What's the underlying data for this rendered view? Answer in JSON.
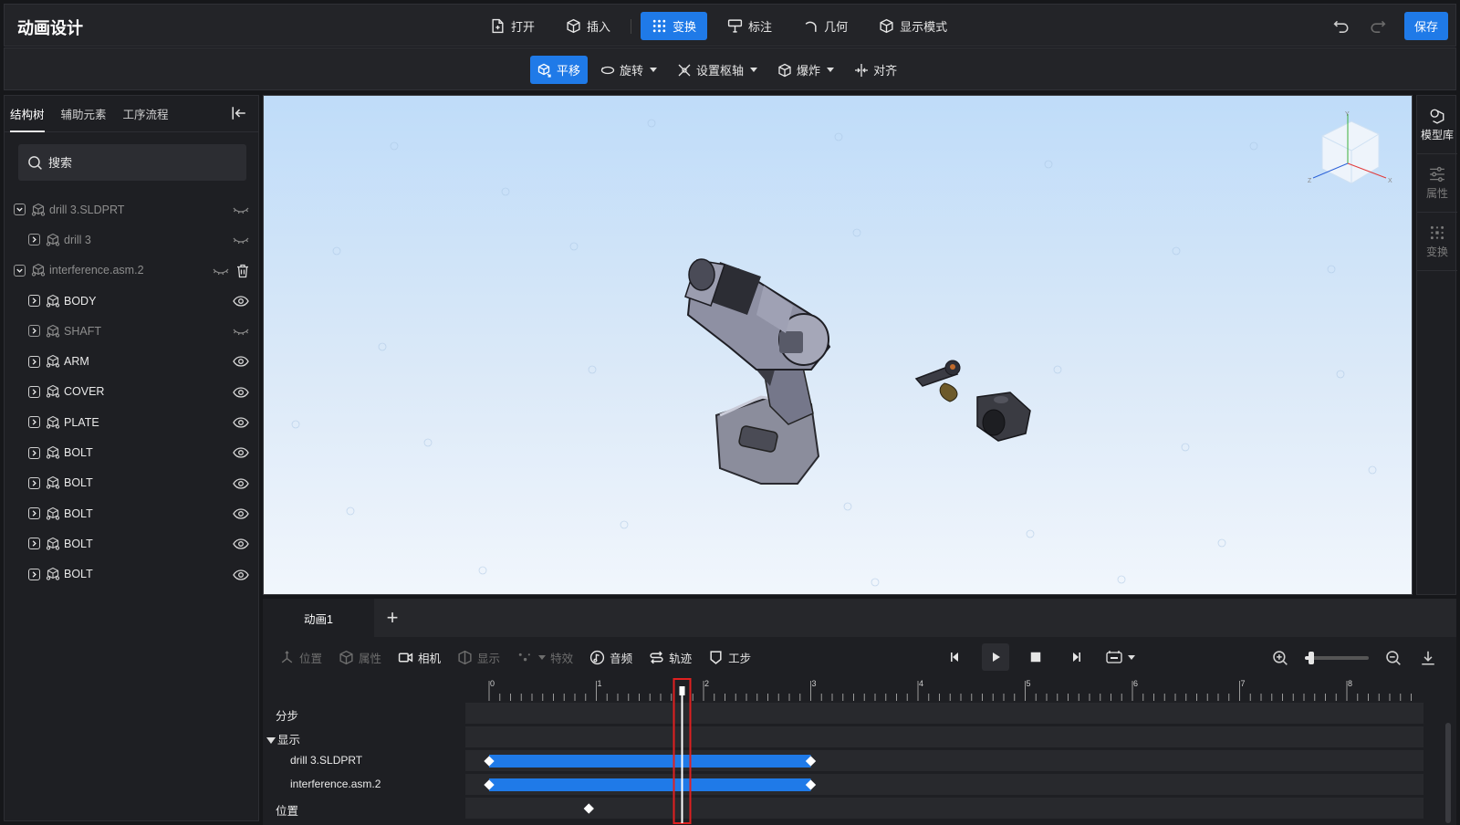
{
  "app": {
    "title": "动画设计"
  },
  "top_menu": [
    {
      "label": "打开",
      "icon": "file-open-icon"
    },
    {
      "label": "插入",
      "icon": "cube-insert-icon"
    },
    {
      "label": "变换",
      "icon": "transform-icon",
      "active": true
    },
    {
      "label": "标注",
      "icon": "annotate-icon"
    },
    {
      "label": "几何",
      "icon": "geometry-icon"
    },
    {
      "label": "显示模式",
      "icon": "display-mode-icon"
    }
  ],
  "top_right": {
    "save_label": "保存"
  },
  "sub_menu": [
    {
      "label": "平移",
      "icon": "translate-icon",
      "active": true
    },
    {
      "label": "旋转",
      "icon": "rotate-icon",
      "dropdown": true
    },
    {
      "label": "设置枢轴",
      "icon": "pivot-icon",
      "dropdown": true
    },
    {
      "label": "爆炸",
      "icon": "explode-icon",
      "dropdown": true
    },
    {
      "label": "对齐",
      "icon": "align-icon"
    }
  ],
  "left_panel": {
    "tabs": [
      "结构树",
      "辅助元素",
      "工序流程"
    ],
    "active_tab": "结构树",
    "search_placeholder": "搜索"
  },
  "tree": [
    {
      "label": "drill 3.SLDPRT",
      "level": 0,
      "expanded": true,
      "visible": false,
      "dim": true
    },
    {
      "label": "drill 3",
      "level": 1,
      "expanded": false,
      "visible": false,
      "dim": true
    },
    {
      "label": "interference.asm.2",
      "level": 0,
      "expanded": true,
      "visible": false,
      "dim": true,
      "deletable": true
    },
    {
      "label": "BODY",
      "level": 1,
      "expanded": false,
      "visible": true
    },
    {
      "label": "SHAFT",
      "level": 1,
      "expanded": false,
      "visible": false,
      "dim": true
    },
    {
      "label": "ARM",
      "level": 1,
      "expanded": false,
      "visible": true
    },
    {
      "label": "COVER",
      "level": 1,
      "expanded": false,
      "visible": true
    },
    {
      "label": "PLATE",
      "level": 1,
      "expanded": false,
      "visible": true
    },
    {
      "label": "BOLT",
      "level": 1,
      "expanded": false,
      "visible": true
    },
    {
      "label": "BOLT",
      "level": 1,
      "expanded": false,
      "visible": true
    },
    {
      "label": "BOLT",
      "level": 1,
      "expanded": false,
      "visible": true
    },
    {
      "label": "BOLT",
      "level": 1,
      "expanded": false,
      "visible": true
    },
    {
      "label": "BOLT",
      "level": 1,
      "expanded": false,
      "visible": true
    }
  ],
  "viewcube": {
    "axis_x": "X",
    "axis_y": "Y",
    "axis_z": "Z"
  },
  "right_rail": [
    {
      "label": "模型库",
      "icon": "model-library-icon",
      "active": true
    },
    {
      "label": "属性",
      "icon": "properties-icon"
    },
    {
      "label": "变换",
      "icon": "transform-rail-icon"
    }
  ],
  "animation": {
    "tabs": [
      "动画1"
    ],
    "add_label": "+",
    "toolbar": [
      {
        "label": "位置",
        "icon": "position-icon",
        "enabled": false
      },
      {
        "label": "属性",
        "icon": "attribute-icon",
        "enabled": false
      },
      {
        "label": "相机",
        "icon": "camera-icon",
        "enabled": true
      },
      {
        "label": "显示",
        "icon": "display-icon",
        "enabled": false
      },
      {
        "label": "特效",
        "icon": "effects-icon",
        "enabled": false
      },
      {
        "label": "音频",
        "icon": "audio-icon",
        "enabled": true
      },
      {
        "label": "轨迹",
        "icon": "trajectory-icon",
        "enabled": true
      },
      {
        "label": "工步",
        "icon": "step-icon",
        "enabled": true
      }
    ],
    "zoom_level": 0.1,
    "timeline": {
      "ruler_labels": [
        "0",
        "1",
        "2",
        "3",
        "4",
        "5",
        "6",
        "7",
        "8"
      ],
      "playhead_time": 1.8,
      "rows": [
        {
          "label": "分步",
          "type": "group"
        },
        {
          "label": "显示",
          "type": "group",
          "expanded": true
        },
        {
          "label": "drill 3.SLDPRT",
          "type": "clip",
          "start": 0,
          "end": 3
        },
        {
          "label": "interference.asm.2",
          "type": "clip",
          "start": 0,
          "end": 3
        },
        {
          "label": "位置",
          "type": "keyframes",
          "keys": [
            0.93
          ]
        }
      ]
    }
  },
  "colors": {
    "accent": "#1f7ae8",
    "panel": "#1e1f23",
    "playhead": "#e02020"
  }
}
